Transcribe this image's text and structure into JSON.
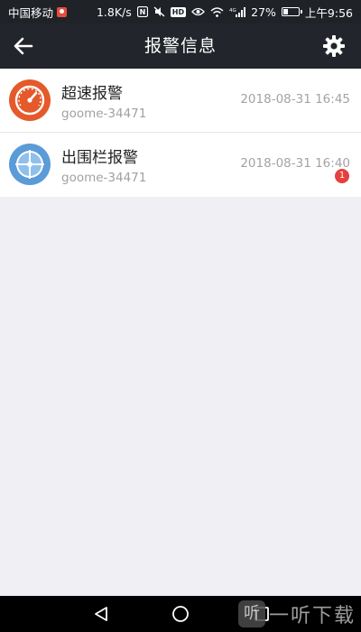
{
  "status_bar": {
    "carrier": "中国移动",
    "network_speed": "1.8K/s",
    "nfc_label": "N",
    "hd_label": "HD",
    "signal_label": "4G",
    "battery_level": 0.27,
    "battery_text": "27%",
    "time": "上午9:56"
  },
  "nav": {
    "title": "报警信息",
    "back_icon": "arrow-left-icon",
    "settings_icon": "gear-icon"
  },
  "alarms": [
    {
      "title": "超速报警",
      "device": "goome-34471",
      "time": "2018-08-31 16:45",
      "icon": "speedometer-icon",
      "icon_color": "#e45a2a",
      "badge": null
    },
    {
      "title": "出围栏报警",
      "device": "goome-34471",
      "time": "2018-08-31 16:40",
      "icon": "crosshair-icon",
      "icon_color": "#5b9bd8",
      "badge": "1"
    }
  ],
  "system_nav": {
    "back_icon": "triangle-back-icon",
    "home_icon": "circle-home-icon",
    "recents_icon": "square-recents-icon"
  },
  "watermark": {
    "logo_text": "听",
    "text": "一听下载"
  },
  "colors": {
    "nav_background": "#22252b",
    "page_background": "#efeff4",
    "badge_red": "#e5403d"
  }
}
